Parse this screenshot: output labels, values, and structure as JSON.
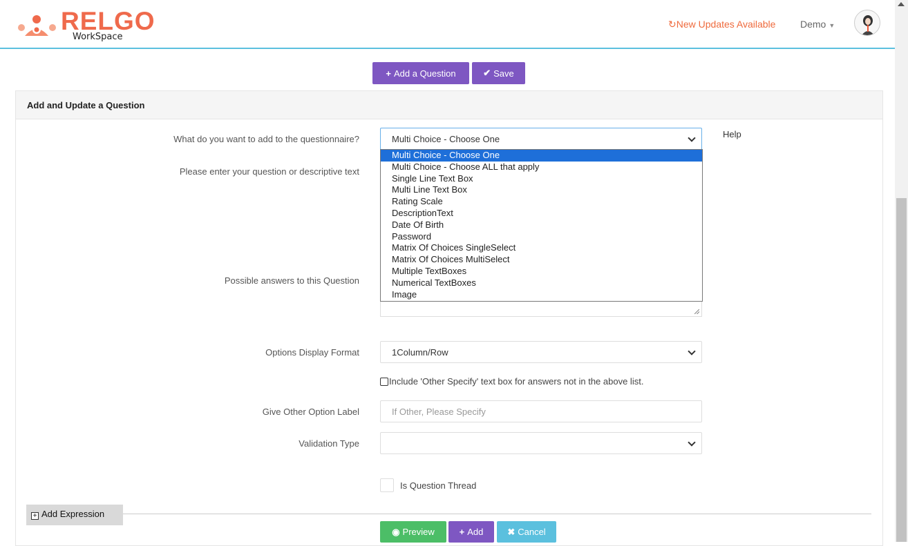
{
  "header": {
    "logo_text": "RELGO",
    "logo_subtext": "WorkSpace",
    "updates_label": "New Updates Available",
    "user_menu_label": "Demo"
  },
  "toolbar": {
    "add_question_label": "Add a Question",
    "save_label": "Save"
  },
  "panel": {
    "title": "Add and Update a Question",
    "help_label": "Help",
    "fields": {
      "type_label": "What do you want to add to the questionnaire?",
      "type_value": "Multi Choice - Choose One",
      "question_label": "Please enter your question or descriptive text",
      "answers_label": "Possible answers to this Question",
      "display_format_label": "Options Display Format",
      "display_format_value": "1Column/Row",
      "other_specify_label": "Include 'Other Specify' text box for answers not in the above list.",
      "other_label_label": "Give Other Option Label",
      "other_label_placeholder": "If Other, Please Specify",
      "validation_label": "Validation Type",
      "validation_value": "",
      "thread_label": "Is Question Thread"
    },
    "type_options": [
      "Multi Choice - Choose One",
      "Multi Choice - Choose ALL that apply",
      "Single Line Text Box",
      "Multi Line Text Box",
      "Rating Scale",
      "DescriptionText",
      "Date Of Birth",
      "Password",
      "Matrix Of Choices SingleSelect",
      "Matrix Of Choices MultiSelect",
      "Multiple TextBoxes",
      "Numerical TextBoxes",
      "Image"
    ],
    "selected_option_index": 0,
    "add_expression_label": "Add Expression",
    "preview_label": "Preview",
    "add_label": "Add",
    "cancel_label": "Cancel"
  },
  "colors": {
    "brand": "#ef6a4c",
    "primary_purple": "#7e57c2",
    "success_green": "#4cbe67",
    "info_cyan": "#5bc0de",
    "selection_blue": "#1e6fd9"
  }
}
